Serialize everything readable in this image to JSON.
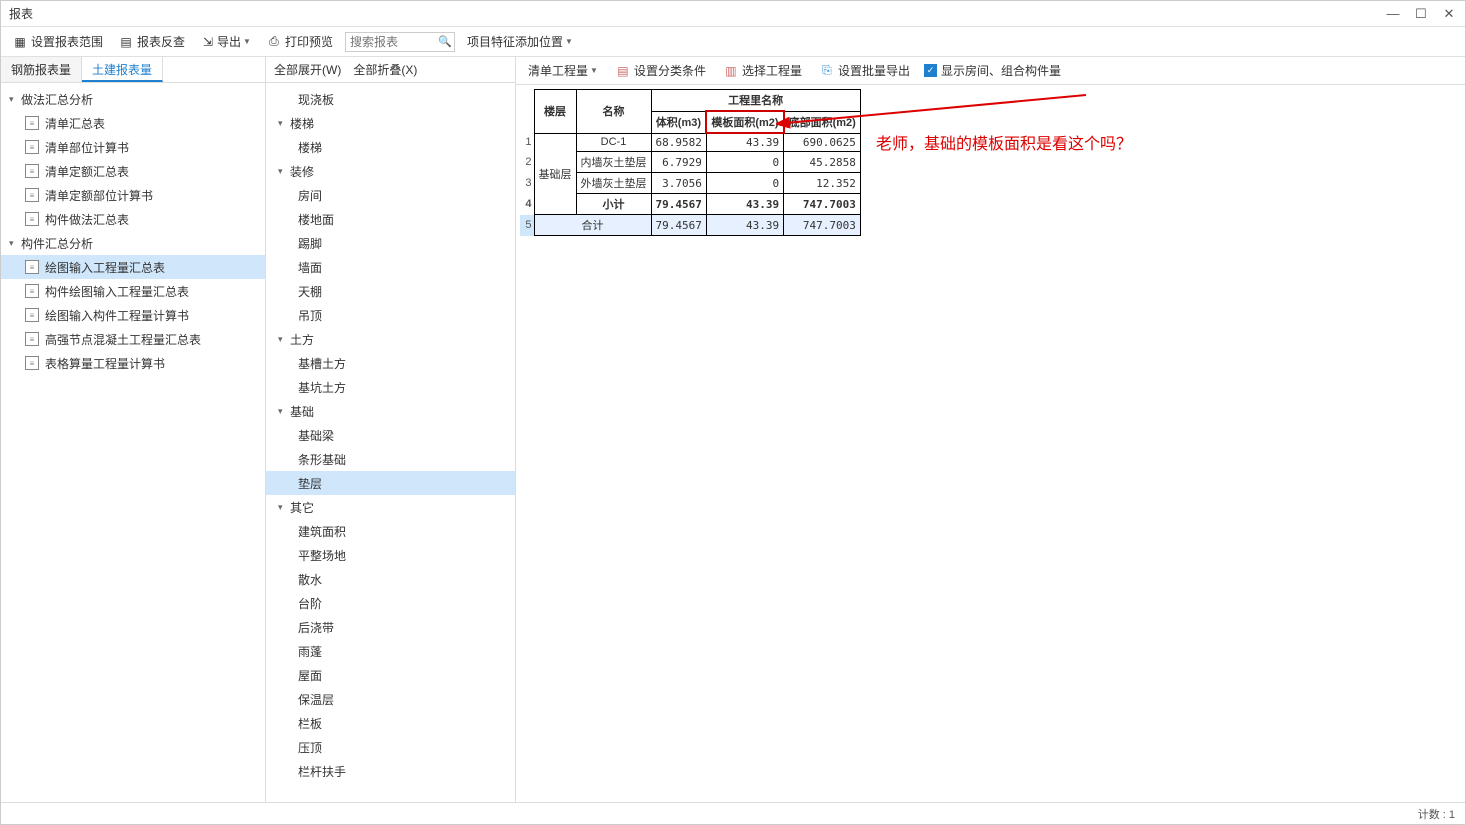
{
  "window": {
    "title": "报表"
  },
  "toolbar": {
    "set_range": "设置报表范围",
    "recheck": "报表反查",
    "export": "导出",
    "print_preview": "打印预览",
    "search_placeholder": "搜索报表",
    "feature_pos": "项目特征添加位置"
  },
  "left_tabs": {
    "rebar": "钢筋报表量",
    "civil": "土建报表量"
  },
  "left_tree": {
    "g1": "做法汇总分析",
    "g1_items": [
      "清单汇总表",
      "清单部位计算书",
      "清单定额汇总表",
      "清单定额部位计算书",
      "构件做法汇总表"
    ],
    "g2": "构件汇总分析",
    "g2_items": [
      "绘图输入工程量汇总表",
      "构件绘图输入工程量汇总表",
      "绘图输入构件工程量计算书",
      "高强节点混凝土工程量汇总表",
      "表格算量工程量计算书"
    ]
  },
  "mid": {
    "expand_all": "全部展开(W)",
    "collapse_all": "全部折叠(X)",
    "items": [
      {
        "type": "leaf",
        "lvl": 1,
        "label": "现浇板"
      },
      {
        "type": "cat",
        "label": "楼梯"
      },
      {
        "type": "leaf",
        "lvl": 1,
        "label": "楼梯"
      },
      {
        "type": "cat",
        "label": "装修"
      },
      {
        "type": "leaf",
        "lvl": 1,
        "label": "房间"
      },
      {
        "type": "leaf",
        "lvl": 1,
        "label": "楼地面"
      },
      {
        "type": "leaf",
        "lvl": 1,
        "label": "踢脚"
      },
      {
        "type": "leaf",
        "lvl": 1,
        "label": "墙面"
      },
      {
        "type": "leaf",
        "lvl": 1,
        "label": "天棚"
      },
      {
        "type": "leaf",
        "lvl": 1,
        "label": "吊顶"
      },
      {
        "type": "cat",
        "label": "土方"
      },
      {
        "type": "leaf",
        "lvl": 1,
        "label": "基槽土方"
      },
      {
        "type": "leaf",
        "lvl": 1,
        "label": "基坑土方"
      },
      {
        "type": "cat",
        "label": "基础"
      },
      {
        "type": "leaf",
        "lvl": 1,
        "label": "基础梁"
      },
      {
        "type": "leaf",
        "lvl": 1,
        "label": "条形基础"
      },
      {
        "type": "leaf",
        "lvl": 1,
        "label": "垫层",
        "sel": true
      },
      {
        "type": "cat",
        "label": "其它"
      },
      {
        "type": "leaf",
        "lvl": 1,
        "label": "建筑面积"
      },
      {
        "type": "leaf",
        "lvl": 1,
        "label": "平整场地"
      },
      {
        "type": "leaf",
        "lvl": 1,
        "label": "散水"
      },
      {
        "type": "leaf",
        "lvl": 1,
        "label": "台阶"
      },
      {
        "type": "leaf",
        "lvl": 1,
        "label": "后浇带"
      },
      {
        "type": "leaf",
        "lvl": 1,
        "label": "雨蓬"
      },
      {
        "type": "leaf",
        "lvl": 1,
        "label": "屋面"
      },
      {
        "type": "leaf",
        "lvl": 1,
        "label": "保温层"
      },
      {
        "type": "leaf",
        "lvl": 1,
        "label": "栏板"
      },
      {
        "type": "leaf",
        "lvl": 1,
        "label": "压顶"
      },
      {
        "type": "leaf",
        "lvl": 1,
        "label": "栏杆扶手"
      }
    ]
  },
  "right_toolbar": {
    "list_qty": "清单工程量",
    "set_cond": "设置分类条件",
    "select_qty": "选择工程量",
    "batch_export": "设置批量导出",
    "show_room": "显示房间、组合构件量"
  },
  "table": {
    "hdr_floor": "楼层",
    "hdr_name": "名称",
    "hdr_qty_name": "工程里名称",
    "hdr_vol": "体积(m3)",
    "hdr_form": "模板面积(m2)",
    "hdr_bottom": "底部面积(m2)",
    "floor_group": "基础层",
    "rows": [
      {
        "n": "1",
        "name": "DC-1",
        "v": "68.9582",
        "f": "43.39",
        "b": "690.0625"
      },
      {
        "n": "2",
        "name": "内墙灰土垫层",
        "v": "6.7929",
        "f": "0",
        "b": "45.2858"
      },
      {
        "n": "3",
        "name": "外墙灰土垫层",
        "v": "3.7056",
        "f": "0",
        "b": "12.352"
      }
    ],
    "subtotal": {
      "n": "4",
      "label": "小计",
      "v": "79.4567",
      "f": "43.39",
      "b": "747.7003"
    },
    "total": {
      "n": "5",
      "label": "合计",
      "v": "79.4567",
      "f": "43.39",
      "b": "747.7003"
    }
  },
  "annotation": "老师，基础的模板面积是看这个吗？",
  "status": "计数 : 1"
}
